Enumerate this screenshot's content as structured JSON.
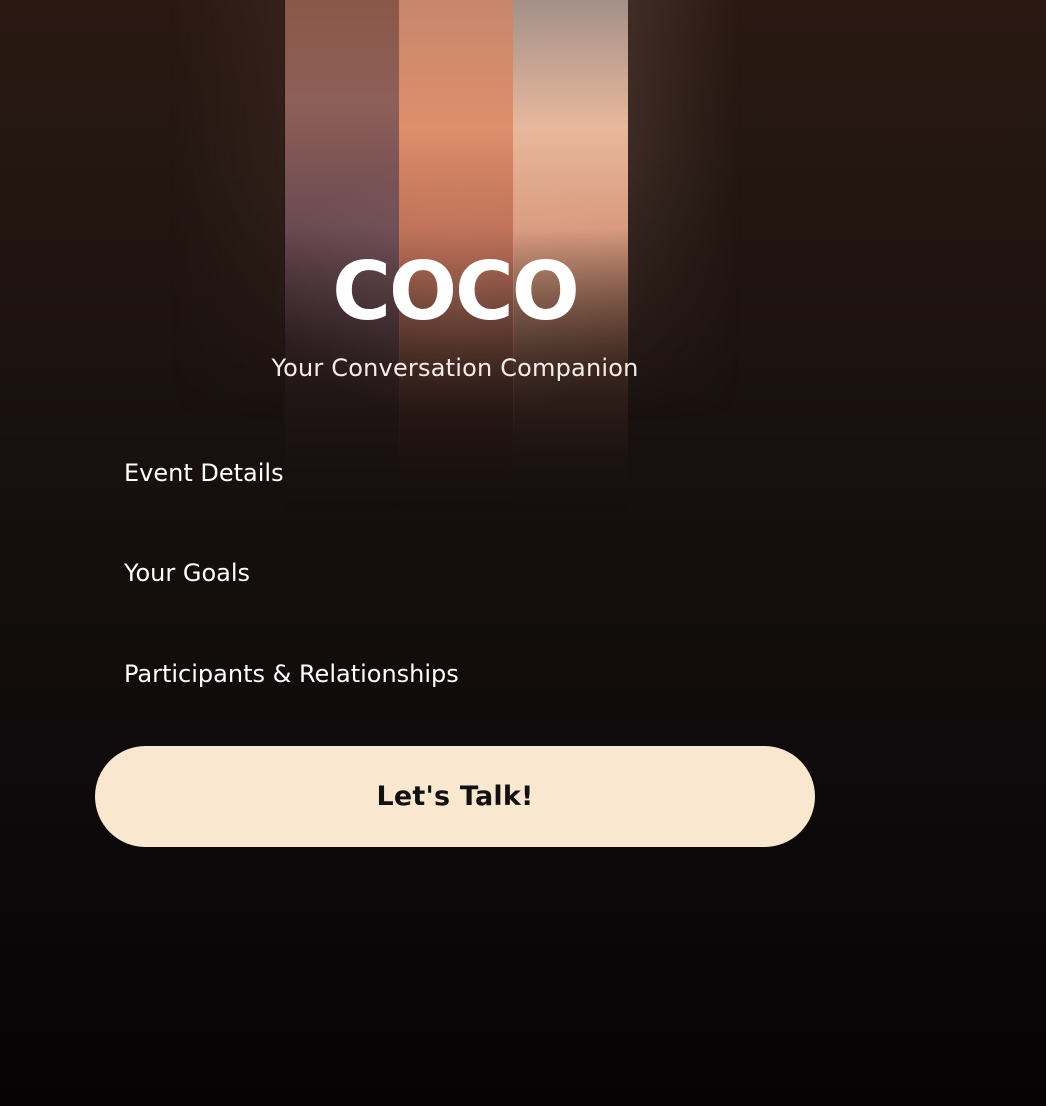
{
  "app": {
    "title": "COCO",
    "subtitle": "Your Conversation Companion"
  },
  "menu": {
    "items": [
      {
        "label": "Event Details"
      },
      {
        "label": "Your Goals"
      },
      {
        "label": "Participants & Relationships"
      }
    ]
  },
  "cta": {
    "label": "Let's Talk!"
  },
  "colors": {
    "background_top": "#2a1913",
    "background_bottom": "#050304",
    "stripe_1": "#8e5f58",
    "stripe_2": "#de8f6c",
    "stripe_3": "#e8b89c",
    "cta_background": "#f9e8cf",
    "cta_text": "#111111",
    "text": "#ffffff"
  }
}
